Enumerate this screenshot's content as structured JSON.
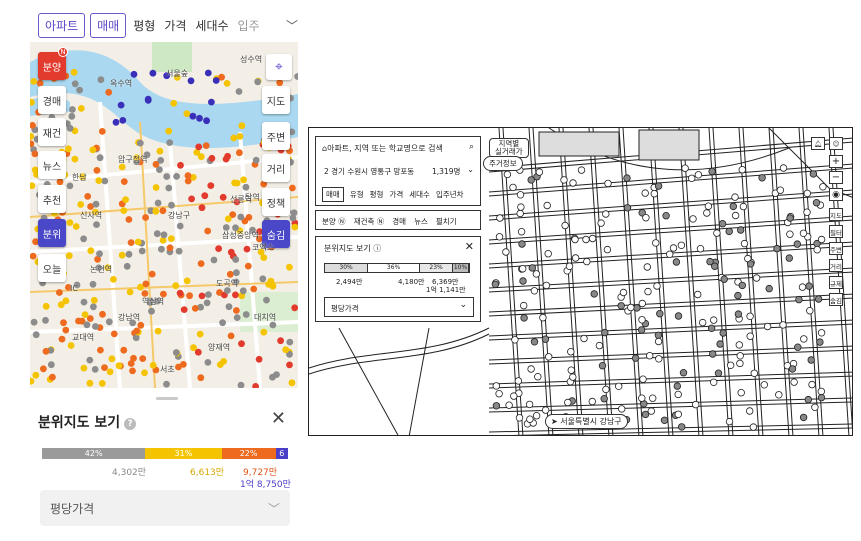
{
  "left": {
    "filters": {
      "chip1": "아파트",
      "chip2": "매매",
      "items": [
        "평형",
        "가격",
        "세대수",
        "입주"
      ]
    },
    "side_buttons": [
      {
        "label": "분양",
        "style": "red",
        "badge": "N"
      },
      {
        "label": "경매",
        "style": "white"
      },
      {
        "label": "재건",
        "style": "white"
      },
      {
        "label": "뉴스",
        "style": "white"
      },
      {
        "label": "추천",
        "style": "white"
      },
      {
        "label": "분위",
        "style": "blue"
      },
      {
        "label": "오늘",
        "style": "white"
      }
    ],
    "right_buttons": [
      {
        "label": "지도",
        "style": "white"
      },
      {
        "label": "주변",
        "style": "white"
      },
      {
        "label": "거리",
        "style": "white"
      },
      {
        "label": "정책",
        "style": "white"
      },
      {
        "label": "숨김",
        "style": "blue"
      }
    ],
    "map_labels": [
      "성수역",
      "서울숲",
      "옥수역",
      "압구정역",
      "신사역",
      "한남",
      "논현역",
      "강남구",
      "선릉역",
      "삼성중앙역",
      "코엑스",
      "역삼역",
      "교대역",
      "서초",
      "강남역",
      "도곡역",
      "양재역",
      "탑역",
      "대치역",
      "IC"
    ],
    "sheet": {
      "title": "분위지도 보기",
      "help": "?",
      "close": "✕",
      "segments": [
        {
          "pct": "42%",
          "color": "#9a9a9a",
          "width": 0.42
        },
        {
          "pct": "31%",
          "color": "#f5c400",
          "width": 0.31
        },
        {
          "pct": "22%",
          "color": "#ee6a1f",
          "width": 0.22
        },
        {
          "pct": "6",
          "color": "#4b3ec8",
          "width": 0.05
        }
      ],
      "p1": "4,302만",
      "p2": "6,613만",
      "p3": "9,727만",
      "p4": "1억 8,750만",
      "select": "평당가격"
    }
  },
  "right": {
    "search_placeholder": "아파트, 지역 또는 학교명으로 검색",
    "location": "2  경기 수원시 영통구 망포동",
    "count": "1,319명",
    "tabs": [
      "매매",
      "유형",
      "평형",
      "가격",
      "세대수",
      "입주년차"
    ],
    "tags": [
      "분양 Ⓝ",
      "재건축 Ⓝ",
      "경매",
      "뉴스",
      "펼치기"
    ],
    "map_tag": "지역별\n실거래가",
    "map_tag2": "주거정보",
    "panel_title": "분위지도 보기",
    "pcts": [
      "30%",
      "36%",
      "23%",
      "10%"
    ],
    "prices": [
      "2,494만",
      "4,180만",
      "6,369만",
      "1억 1,141만"
    ],
    "select": "평당가격",
    "bottom_tag": "서울특별시 강남구",
    "right_buttons": [
      "지도",
      "필터",
      "주변",
      "거리",
      "규제",
      "숨김"
    ]
  }
}
